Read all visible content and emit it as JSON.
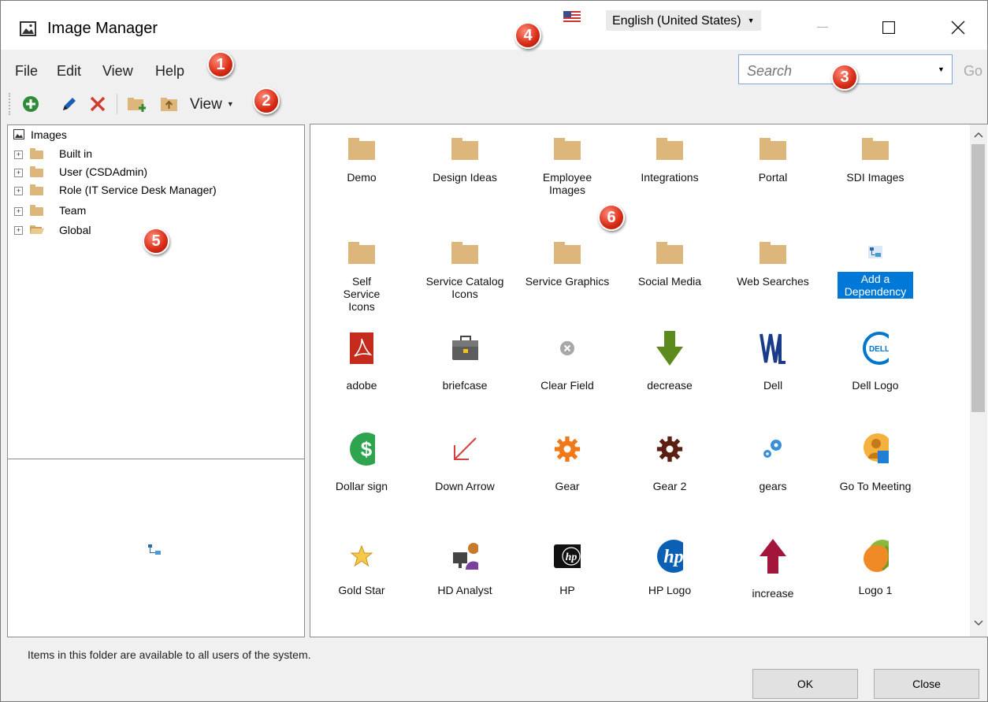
{
  "window": {
    "title": "Image Manager"
  },
  "language": {
    "selected": "English (United States)"
  },
  "menu": [
    "File",
    "Edit",
    "View",
    "Help"
  ],
  "search": {
    "placeholder": "Search",
    "go_label": "Go"
  },
  "toolbar": {
    "view_label": "View"
  },
  "tree": {
    "root": "Images",
    "nodes": [
      "Built in",
      "User (CSDAdmin)",
      "Role (IT Service Desk Manager)",
      "Team",
      "Global"
    ],
    "selected": "Global"
  },
  "gallery": {
    "items": [
      {
        "label": "Demo",
        "icon": "folder-icon"
      },
      {
        "label": "Design Ideas",
        "icon": "folder-icon"
      },
      {
        "label": "Employee Images",
        "icon": "folder-icon"
      },
      {
        "label": "Integrations",
        "icon": "folder-icon"
      },
      {
        "label": "Portal",
        "icon": "folder-icon"
      },
      {
        "label": "SDI Images",
        "icon": "folder-icon"
      },
      {
        "label": "Self Service Icons",
        "icon": "folder-icon"
      },
      {
        "label": "Service Catalog Icons",
        "icon": "folder-icon"
      },
      {
        "label": "Service Graphics",
        "icon": "folder-icon"
      },
      {
        "label": "Social Media",
        "icon": "folder-icon"
      },
      {
        "label": "Web Searches",
        "icon": "folder-icon"
      },
      {
        "label": "Add a Dependency",
        "icon": "dependency-icon",
        "selected": true
      },
      {
        "label": "adobe",
        "icon": "adobe-icon"
      },
      {
        "label": "briefcase",
        "icon": "briefcase-icon"
      },
      {
        "label": "Clear Field",
        "icon": "clear-field-icon"
      },
      {
        "label": "decrease",
        "icon": "decrease-arrow-icon"
      },
      {
        "label": "Dell",
        "icon": "dell-icon"
      },
      {
        "label": "Dell Logo",
        "icon": "dell-logo-icon"
      },
      {
        "label": "Dollar sign",
        "icon": "dollar-sign-icon"
      },
      {
        "label": "Down Arrow",
        "icon": "down-arrow-icon"
      },
      {
        "label": "Gear",
        "icon": "gear-icon"
      },
      {
        "label": "Gear 2",
        "icon": "gear-2-icon"
      },
      {
        "label": "gears",
        "icon": "gears-icon"
      },
      {
        "label": "Go To Meeting",
        "icon": "go-to-meeting-icon"
      },
      {
        "label": "Gold Star",
        "icon": "gold-star-icon"
      },
      {
        "label": "HD Analyst",
        "icon": "hd-analyst-icon"
      },
      {
        "label": "HP",
        "icon": "hp-icon"
      },
      {
        "label": "HP Logo",
        "icon": "hp-logo-icon"
      },
      {
        "label": "increase",
        "icon": "increase-arrow-icon"
      },
      {
        "label": "Logo 1",
        "icon": "logo-1-icon"
      }
    ]
  },
  "status_text": "Items in this folder are available to all users of the system.",
  "buttons": {
    "ok": "OK",
    "close": "Close"
  },
  "callouts": [
    "1",
    "2",
    "3",
    "4",
    "5",
    "6"
  ],
  "colors": {
    "folder": "#dcb67a",
    "selection": "#0078d7",
    "callout": "#d62a14"
  }
}
